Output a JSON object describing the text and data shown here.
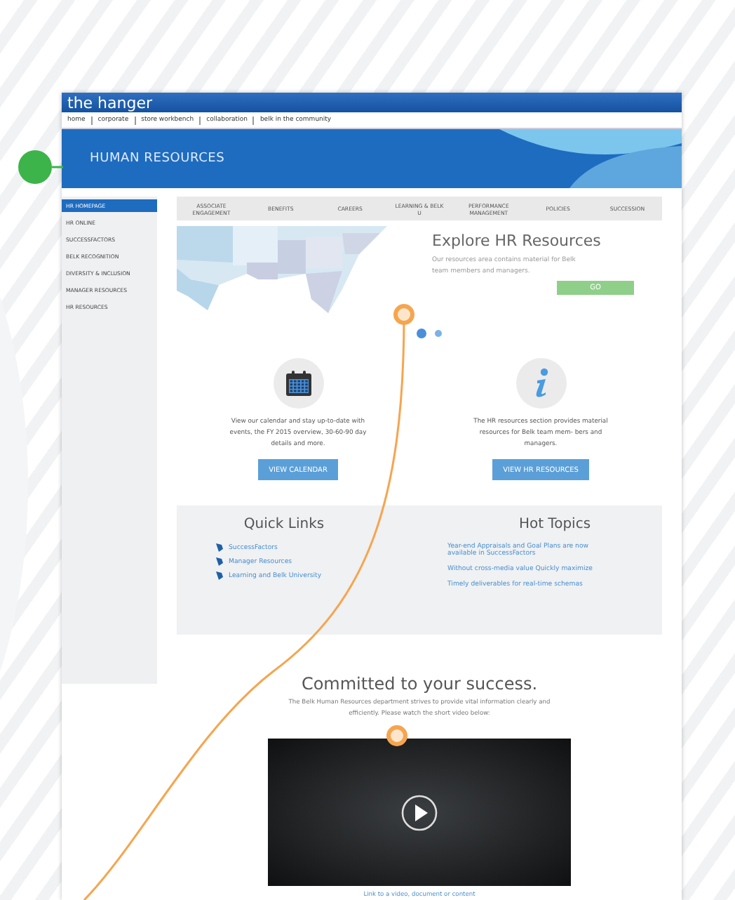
{
  "site": {
    "title": "the hanger",
    "nav": [
      "home",
      "corporate",
      "store workbench",
      "collaboration",
      "belk in the community"
    ]
  },
  "banner": {
    "title": "HUMAN RESOURCES"
  },
  "sidebar": {
    "items": [
      {
        "label": "HR HOMEPAGE",
        "selected": true
      },
      {
        "label": "HR ONLINE",
        "selected": false
      },
      {
        "label": "SUCCESSFACTORS",
        "selected": false
      },
      {
        "label": "BELK RECOGNITION",
        "selected": false
      },
      {
        "label": "DIVERSITY & INCLUSION",
        "selected": false
      },
      {
        "label": "MANAGER RESOURCES",
        "selected": false
      },
      {
        "label": "HR RESOURCES",
        "selected": false
      }
    ]
  },
  "tabs": [
    "ASSOCIATE ENGAGEMENT",
    "BENEFITS",
    "CAREERS",
    "LEARNING & BELK U",
    "PERFORMANCE MANAGEMENT",
    "POLICIES",
    "SUCCESSION"
  ],
  "hero": {
    "title": "Explore HR Resources",
    "text": "Our resources area contains material for Belk team members and managers.",
    "button": "GO",
    "slides": [
      {
        "selected": true
      },
      {
        "selected": false
      }
    ]
  },
  "features": [
    {
      "kind": "calendar",
      "text": "View our calendar and stay up-to-date with events, the FY 2015 overview, 30-60-90 day details and more.",
      "button": "VIEW CALENDAR"
    },
    {
      "kind": "info",
      "text": "The HR resources section provides material resources for Belk team mem- bers and managers.",
      "button": "VIEW HR RESOURCES"
    }
  ],
  "quick_links": {
    "title": "Quick Links",
    "items": [
      "SuccessFactors",
      "Manager Resources",
      "Learning and Belk University"
    ]
  },
  "hot_topics": {
    "title": "Hot Topics",
    "items": [
      "Year-end Appraisals and Goal Plans are now available in SuccessFactors",
      "Without cross-media value Quickly maximize",
      "Timely deliverables for real-time schemas"
    ]
  },
  "committed": {
    "title": "Committed to your success.",
    "text": "The Belk Human Resources department strives to provide vital information clearly and efficiently. Please watch the short video below:",
    "link": "Link to a video, document or content"
  }
}
